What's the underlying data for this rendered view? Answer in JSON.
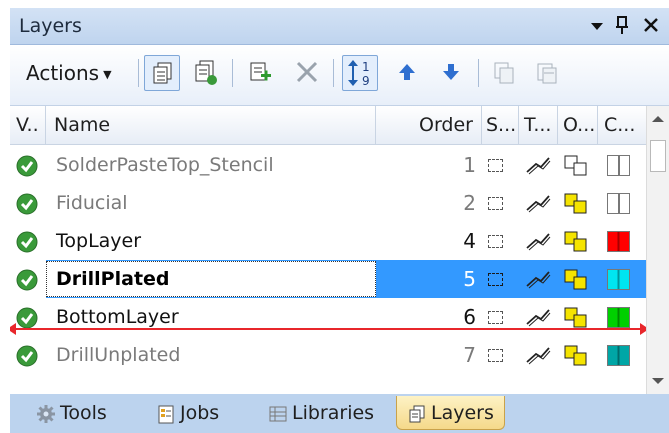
{
  "panel": {
    "title": "Layers"
  },
  "titlebar": {
    "dropdown_glyph": "▼",
    "pin_glyph": "📌",
    "close_glyph": "✕"
  },
  "toolbar": {
    "actions_label": "Actions",
    "tools": [
      {
        "icon": "layer-view-icon"
      },
      {
        "icon": "layer-sets-icon"
      },
      {
        "icon": "add-layer-icon"
      },
      {
        "icon": "delete-icon"
      },
      {
        "icon": "sort-order-icon"
      },
      {
        "icon": "move-up-icon"
      },
      {
        "icon": "move-down-icon"
      },
      {
        "icon": "copy-layer-icon"
      },
      {
        "icon": "paste-layer-icon"
      }
    ],
    "sort_glyph_top": "1",
    "sort_glyph_bottom": "9"
  },
  "columns": {
    "v": "V..",
    "name": "Name",
    "order": "Order",
    "s": "S...",
    "t": "T...",
    "o": "O...",
    "c": "C..."
  },
  "rows": [
    {
      "name": "SolderPasteTop_Stencil",
      "order": "1",
      "color": "#ffffff",
      "dim": true
    },
    {
      "name": "Fiducial",
      "order": "2",
      "color": "#ffffff",
      "dim": true
    },
    {
      "name": "TopLayer",
      "order": "4",
      "color": "#ff0000",
      "dim": false
    },
    {
      "name": "DrillPlated",
      "order": "5",
      "color": "#00e5f0",
      "dim": false,
      "selected": true
    },
    {
      "name": "BottomLayer",
      "order": "6",
      "color": "#00d000",
      "dim": false
    },
    {
      "name": "DrillUnplated",
      "order": "7",
      "color": "#00a6a6",
      "dim": true
    }
  ],
  "tabs": [
    {
      "label": "Tools",
      "icon": "gear-icon"
    },
    {
      "label": "Jobs",
      "icon": "jobs-icon"
    },
    {
      "label": "Libraries",
      "icon": "libraries-icon"
    },
    {
      "label": "Layers",
      "icon": "layers-icon",
      "active": true
    }
  ],
  "colors": {
    "accent": "#3399ff",
    "check": "#3a9a3a",
    "indicator": "#e8262b"
  }
}
